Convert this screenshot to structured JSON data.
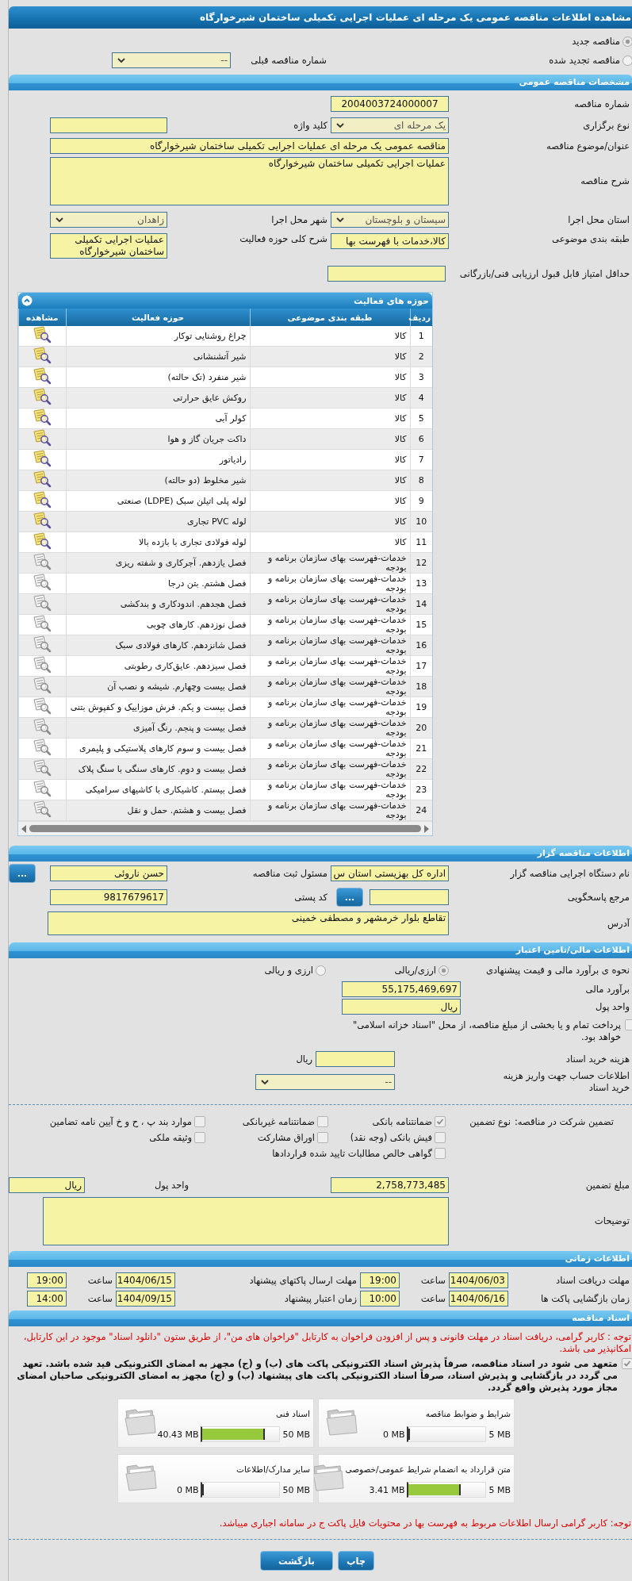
{
  "title": "مشاهده اطلاعات مناقصه عمومی یک مرحله ای عملیات اجرایی تکمیلی ساختمان شیرخوارگاه",
  "tender_kind": [
    {
      "label": "مناقصه جدید",
      "selected": true
    },
    {
      "label": "مناقصه تجدید شده",
      "selected": false
    }
  ],
  "previous_tender": {
    "label": "شماره مناقصه قبلی",
    "value": "--"
  },
  "general": {
    "header": "مشخصات مناقصه عمومی",
    "tender_number": {
      "label": "شماره مناقصه",
      "value": "2004003724000007"
    },
    "holding_type": {
      "label": "نوع برگزاری",
      "value": "یک مرحله ای"
    },
    "keyword": {
      "label": "کلید واژه"
    },
    "subject": {
      "label": "عنوان/موضوع مناقصه",
      "value": "مناقصه عمومی یک مرحله ای عملیات اجرایی تکمیلی ساختمان شیرخوارگاه"
    },
    "description": {
      "label": "شرح مناقصه",
      "value": "عملیات اجرایی تکمیلی ساختمان شیرخوارگاه"
    },
    "province": {
      "label": "استان محل اجرا",
      "value": "سیستان و بلوچستان"
    },
    "city": {
      "label": "شهر محل اجرا",
      "value": "زاهدان"
    },
    "category": {
      "label": "طبقه بندی موضوعی",
      "value": "کالا،خدمات با فهرست بها"
    },
    "activity_summary": {
      "label": "شرح کلی حوزه فعالیت",
      "value": "عملیات اجرایی تکمیلی ساختمان شیرخوارگاه"
    },
    "min_score": {
      "label": "حداقل امتیاز قابل قبول ارزیابی فنی/بازرگانی"
    }
  },
  "activities": {
    "title": "حوزه های فعالیت",
    "expanded": true,
    "columns": [
      "ردیف",
      "طبقه بندی موضوعی",
      "حوزه فعالیت",
      "مشاهده"
    ],
    "rows": [
      {
        "index": "1",
        "category": "کالا",
        "activity": "چراغ روشنایی توکار",
        "viewable": true
      },
      {
        "index": "2",
        "category": "کالا",
        "activity": "شیر آتشنشانی",
        "viewable": true
      },
      {
        "index": "3",
        "category": "کالا",
        "activity": "شیر منفرد (تک حالته)",
        "viewable": true
      },
      {
        "index": "4",
        "category": "کالا",
        "activity": "روکش عایق حرارتی",
        "viewable": true
      },
      {
        "index": "5",
        "category": "کالا",
        "activity": "کولر آبی",
        "viewable": true
      },
      {
        "index": "6",
        "category": "کالا",
        "activity": "داکت جریان گاز و هوا",
        "viewable": true
      },
      {
        "index": "7",
        "category": "کالا",
        "activity": "رادیاتور",
        "viewable": true
      },
      {
        "index": "8",
        "category": "کالا",
        "activity": "شیر مخلوط (دو حالته)",
        "viewable": true
      },
      {
        "index": "9",
        "category": "کالا",
        "activity": "لوله پلی اتیلن سبک (LDPE) صنعتی",
        "viewable": true
      },
      {
        "index": "10",
        "category": "کالا",
        "activity": "لوله PVC تجاری",
        "viewable": true
      },
      {
        "index": "11",
        "category": "کالا",
        "activity": "لوله فولادی تجاری با بازده بالا",
        "viewable": true
      },
      {
        "index": "12",
        "category": "خدمات-فهرست بهای سازمان برنامه و بودجه",
        "activity": "فصل یازدهم. آجرکاری و شفته ریزی",
        "viewable": false
      },
      {
        "index": "13",
        "category": "خدمات-فهرست بهای سازمان برنامه و بودجه",
        "activity": "فصل هشتم. بتن درجا",
        "viewable": false
      },
      {
        "index": "14",
        "category": "خدمات-فهرست بهای سازمان برنامه و بودجه",
        "activity": "فصل هجدهم. اندودکاری و بندکشی",
        "viewable": false
      },
      {
        "index": "15",
        "category": "خدمات-فهرست بهای سازمان برنامه و بودجه",
        "activity": "فصل نوزدهم. کارهای چوبی",
        "viewable": false
      },
      {
        "index": "16",
        "category": "خدمات-فهرست بهای سازمان برنامه و بودجه",
        "activity": "فصل شانزدهم. کارهای فولادی سبک",
        "viewable": false
      },
      {
        "index": "17",
        "category": "خدمات-فهرست بهای سازمان برنامه و بودجه",
        "activity": "فصل سیزدهم. عایق‌کاری رطوبتی",
        "viewable": false
      },
      {
        "index": "18",
        "category": "خدمات-فهرست بهای سازمان برنامه و بودجه",
        "activity": "فصل بیست وچهارم. شیشه و نصب آن",
        "viewable": false
      },
      {
        "index": "19",
        "category": "خدمات-فهرست بهای سازمان برنامه و بودجه",
        "activity": "فصل بیست و یکم. فرش موزاییک و کفپوش بتنی",
        "viewable": false
      },
      {
        "index": "20",
        "category": "خدمات-فهرست بهای سازمان برنامه و بودجه",
        "activity": "فصل بیست و پنجم. رنگ آمیزی",
        "viewable": false
      },
      {
        "index": "21",
        "category": "خدمات-فهرست بهای سازمان برنامه و بودجه",
        "activity": "فصل بیست و سوم کارهای پلاستیکی و پلیمری",
        "viewable": false
      },
      {
        "index": "22",
        "category": "خدمات-فهرست بهای سازمان برنامه و بودجه",
        "activity": "فصل بیست و دوم. کارهای سنگی با سنگ پلاک",
        "viewable": false
      },
      {
        "index": "23",
        "category": "خدمات-فهرست بهای سازمان برنامه و بودجه",
        "activity": "فصل بیستم. کاشیکاری با کاشیهای سرامیکی",
        "viewable": false
      },
      {
        "index": "24",
        "category": "خدمات-فهرست بهای سازمان برنامه و بودجه",
        "activity": "فصل بیست و هشتم. حمل و نقل",
        "viewable": false
      }
    ]
  },
  "organizer": {
    "header": "اطلاعات مناقصه گزار",
    "agency": {
      "label": "نام دستگاه اجرایی مناقصه گزار",
      "value": "اداره کل بهزیستی استان س"
    },
    "registrar": {
      "label": "مسئول ثبت مناقصه",
      "value": "حسن ناروئی",
      "button": "..."
    },
    "reference": {
      "label": "مرجع پاسخگویی",
      "button": "..."
    },
    "postal_code": {
      "label": "کد پستی",
      "value": "9817679617"
    },
    "address": {
      "label": "آدرس",
      "value": "تقاطع بلوار خرمشهر و مصطفی خمینی"
    }
  },
  "financial": {
    "header": "اطلاعات مالی/تامین اعتبار",
    "estimate_method": {
      "label": "نحوه ی برآورد مالی و قیمت پیشنهادی",
      "options": [
        {
          "label": "ارزی/ریالی",
          "selected": true
        },
        {
          "label": "ارزی و ریالی",
          "selected": false
        }
      ]
    },
    "estimate": {
      "label": "برآورد مالی",
      "value": "55,175,469,697"
    },
    "currency": {
      "label": "واحد پول",
      "value": "ریال"
    },
    "treasury": {
      "label": "پرداخت تمام و یا بخشی از مبلغ مناقصه، از محل \"اسناد خزانه اسلامی\" خواهد بود.",
      "checked": false
    },
    "document_fee": {
      "label": "هزینه خرید اسناد",
      "unit": "ریال"
    },
    "account": {
      "label": "اطلاعات حساب جهت واریز هزینه خرید اسناد",
      "value": "--"
    },
    "guarantee_label": "تضمین شرکت در مناقصه:",
    "guarantee_type_label": "نوع تضمین",
    "guarantee_types": [
      {
        "label": "ضمانتنامه بانکی",
        "checked": true
      },
      {
        "label": "ضمانتنامه غیربانکی",
        "checked": false
      },
      {
        "label": "موارد بند پ ، ح و خ آیین نامه تضامین",
        "checked": false
      },
      {
        "label": "فیش بانکی (وجه نقد)",
        "checked": false
      },
      {
        "label": "اوراق مشارکت",
        "checked": false
      },
      {
        "label": "وثیقه ملکی",
        "checked": false
      },
      {
        "label": "گواهی خالص مطالبات تایید شده قراردادها",
        "checked": false
      }
    ],
    "guarantee_amount": {
      "label": "مبلغ تضمین",
      "value": "2,758,773,485"
    },
    "guarantee_currency": {
      "label": "واحد پول",
      "value": "ریال"
    },
    "notes": {
      "label": "توضیحات"
    }
  },
  "timing": {
    "header": "اطلاعات زمانی",
    "rows": [
      [
        {
          "label": "مهلت دریافت اسناد",
          "date": "1404/06/03",
          "time_label": "ساعت",
          "time": "19:00"
        },
        {
          "label": "مهلت ارسال پاکتهای پیشنهاد",
          "date": "1404/06/15",
          "time_label": "ساعت",
          "time": "19:00"
        }
      ],
      [
        {
          "label": "زمان بازگشایی پاکت ها",
          "date": "1404/06/16",
          "time_label": "ساعت",
          "time": "10:00"
        },
        {
          "label": "زمان اعتبار پیشنهاد",
          "date": "1404/09/15",
          "time_label": "ساعت",
          "time": "14:00"
        }
      ]
    ]
  },
  "documents": {
    "header": "اسناد مناقصه",
    "notice": "توجه : کاربر گرامی، دریافت اسناد در مهلت قانونی و پس از افزودن فراخوان به کارتابل \"فراخوان های من\"، از طریق ستون \"دانلود اسناد\" موجود در این کارتابل، امکانپذیر می باشد.",
    "commitment": {
      "label": "متعهد می شود در اسناد مناقصه، صرفاً پذیرش اسناد الکترونیکی پاکت های (ب) و (ج) مجهز به امضای الکترونیکی قید شده باشد. تعهد می گردد در بازگشایی و پذیرش اسناد، صرفاً اسناد الکترونیکی پاکت های پیشنهاد (ب) و (ج) مجهز به امضای الکترونیکی صاحبان امضای مجاز مورد پذیرش واقع گردد.",
      "checked": true
    },
    "files": [
      {
        "title": "شرایط و ضوابط مناقصه",
        "limit": "5 MB",
        "used": "0 MB",
        "level": 0
      },
      {
        "title": "اسناد فنی",
        "limit": "50 MB",
        "used": "40.43 MB",
        "level": 0.81
      },
      {
        "title": "متن قرارداد به انضمام شرایط عمومی/خصوصی",
        "limit": "5 MB",
        "used": "3.41 MB",
        "level": 0.68
      },
      {
        "title": "سایر مدارک/اطلاعات",
        "limit": "50 MB",
        "used": "0 MB",
        "level": 0
      }
    ],
    "price_notice": "توجه: کاربر گرامی ارسال اطلاعات مربوط به فهرست بها در محتویات فایل پاکت ج در سامانه اجباری میباشد."
  },
  "buttons": [
    "چاپ",
    "بازگشت"
  ]
}
